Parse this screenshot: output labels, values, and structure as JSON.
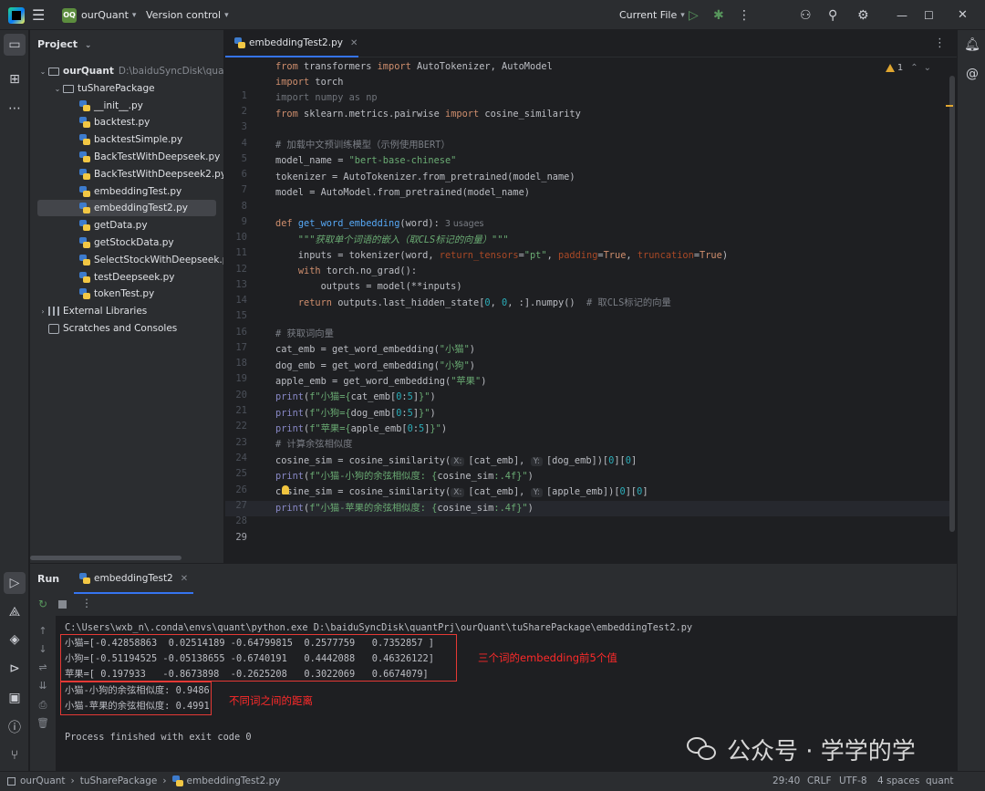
{
  "titlebar": {
    "project_badge": "OQ",
    "project_name": "ourQuant",
    "vcs": "Version control",
    "run_config": "Current File",
    "icons": [
      "main-menu-icon",
      "run-icon",
      "debug-icon",
      "more-icon",
      "add-user-icon",
      "search-icon",
      "settings-icon",
      "minimize-icon",
      "maximize-icon",
      "close-icon"
    ]
  },
  "project_panel": {
    "title": "Project",
    "root": {
      "name": "ourQuant",
      "path": "D:\\baiduSyncDisk\\quantPrj"
    },
    "package": "tuSharePackage",
    "files": [
      "__init__.py",
      "backtest.py",
      "backtestSimple.py",
      "BackTestWithDeepseek.py",
      "BackTestWithDeepseek2.py",
      "embeddingTest.py",
      "embeddingTest2.py",
      "getData.py",
      "getStockData.py",
      "SelectStockWithDeepseek.py",
      "testDeepseek.py",
      "tokenTest.py"
    ],
    "selected_file": "embeddingTest2.py",
    "external_libraries": "External Libraries",
    "scratches": "Scratches and Consoles"
  },
  "editor": {
    "tab": "embeddingTest2.py",
    "warning_count": "1",
    "current_line": 29,
    "line_numbers": [
      "1",
      "2",
      "3",
      "4",
      "5",
      "6",
      "7",
      "8",
      "9",
      "10",
      "11",
      "12",
      "13",
      "14",
      "15",
      "16",
      "17",
      "18",
      "19",
      "20",
      "21",
      "22",
      "23",
      "24",
      "25",
      "26",
      "27",
      "28",
      "29"
    ],
    "code": {
      "l1": [
        "from",
        " transformers ",
        "import",
        " AutoTokenizer, AutoModel"
      ],
      "l2": [
        "import",
        " torch"
      ],
      "l3": "import numpy as np",
      "l4": [
        "from",
        " sklearn.metrics.pairwise ",
        "import",
        " cosine_similarity"
      ],
      "l6": "# 加载中文预训练模型（示例使用BERT）",
      "l7": [
        "model_name = ",
        "\"bert-base-chinese\""
      ],
      "l8": "tokenizer = AutoTokenizer.from_pretrained(model_name)",
      "l9": "model = AutoModel.from_pretrained(model_name)",
      "l11": [
        "def",
        " ",
        "get_word_embedding",
        "(word):",
        "3 usages"
      ],
      "l12": "    \"\"\"获取单个词语的嵌入（取CLS标记的向量）\"\"\"",
      "l13": [
        "    inputs = tokenizer(word, ",
        "return_tensors",
        "=",
        "\"pt\"",
        ", ",
        "padding",
        "=",
        "True",
        ", ",
        "truncation",
        "=",
        "True",
        ")"
      ],
      "l14": [
        "    ",
        "with",
        " torch.no_grad():"
      ],
      "l15": "        outputs = model(**inputs)",
      "l16": [
        "    ",
        "return",
        " outputs.last_hidden_state[",
        "0",
        ", ",
        "0",
        ", :].numpy()  ",
        "# 取CLS标记的向量"
      ],
      "l18": "# 获取词向量",
      "l19": [
        "cat_emb = get_word_embedding(",
        "\"小猫\"",
        ")"
      ],
      "l20": [
        "dog_emb = get_word_embedding(",
        "\"小狗\"",
        ")"
      ],
      "l21": [
        "apple_emb = get_word_embedding(",
        "\"苹果\"",
        ")"
      ],
      "l22": [
        "print",
        "(",
        "f\"小猫={",
        "cat_emb[",
        "0",
        ":",
        "5",
        "]",
        "}\"",
        ")"
      ],
      "l23": [
        "print",
        "(",
        "f\"小狗={",
        "dog_emb[",
        "0",
        ":",
        "5",
        "]",
        "}\"",
        ")"
      ],
      "l24": [
        "print",
        "(",
        "f\"苹果={",
        "apple_emb[",
        "0",
        ":",
        "5",
        "]",
        "}\"",
        ")"
      ],
      "l25": "# 计算余弦相似度",
      "l26": [
        "cosine_sim = cosine_similarity(",
        "X:",
        "[cat_emb], ",
        "Y:",
        "[dog_emb])[",
        "0",
        "][",
        "0",
        "]"
      ],
      "l27": [
        "print",
        "(",
        "f\"小猫-小狗的余弦相似度: {",
        "cosine_sim",
        ":.4f",
        "}\"",
        ")"
      ],
      "l28": [
        "cosine_sim = cosine_similarity(",
        "X:",
        "[cat_emb], ",
        "Y:",
        "[apple_emb])[",
        "0",
        "][",
        "0",
        "]"
      ],
      "l29": [
        "print",
        "(",
        "f\"小猫-苹果的余弦相似度: {",
        "cosine_sim",
        ":.4f",
        "}\"",
        ")"
      ]
    }
  },
  "run_panel": {
    "title": "Run",
    "tab": "embeddingTest2",
    "output": [
      "C:\\Users\\wxb_n\\.conda\\envs\\quant\\python.exe D:\\baiduSyncDisk\\quantPrj\\ourQuant\\tuSharePackage\\embeddingTest2.py",
      "小猫=[-0.42858863  0.02514189 -0.64799815  0.2577759   0.7352857 ]",
      "小狗=[-0.51194525 -0.05138655 -0.6740191   0.4442088   0.46326122]",
      "苹果=[ 0.197933   -0.8673898  -0.2625208   0.3022069   0.6674079]",
      "小猫-小狗的余弦相似度: 0.9486",
      "小猫-苹果的余弦相似度: 0.4991",
      "",
      "Process finished with exit code 0"
    ],
    "annotation_1": "三个词的embedding前5个值",
    "annotation_2": "不同词之间的距离",
    "watermark": "公众号 · 学学的学",
    "annotation_color": "#ff2a2a"
  },
  "statusbar": {
    "breadcrumb": [
      "ourQuant",
      "tuSharePackage",
      "embeddingTest2.py"
    ],
    "position": "29:40",
    "line_sep": "CRLF",
    "encoding": "UTF-8",
    "indent": "4 spaces",
    "interpreter": "quant"
  },
  "colors": {
    "accent": "#3574f0",
    "keyword": "#cf8e6d",
    "string": "#6aab73",
    "function": "#56a8f5",
    "number": "#2aacb8",
    "kwarg": "#aa4926"
  }
}
